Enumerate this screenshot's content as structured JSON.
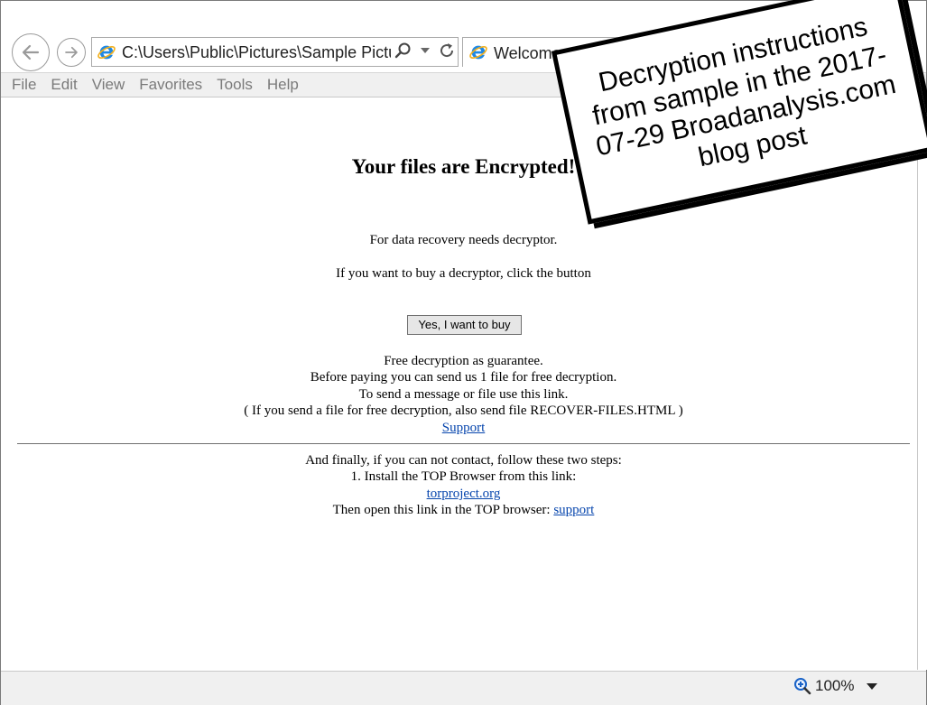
{
  "browser": {
    "address": "C:\\Users\\Public\\Pictures\\Sample Pictu",
    "tab_title": "Welcome",
    "menu": [
      "File",
      "Edit",
      "View",
      "Favorites",
      "Tools",
      "Help"
    ],
    "zoom": "100%"
  },
  "page": {
    "heading": "Your files are Encrypted!",
    "line1": "For data recovery needs decryptor.",
    "line2": "If you want to buy a decryptor, click the button",
    "button_label": "Yes, I want to buy",
    "guarantee": "Free decryption as guarantee.",
    "before_paying": "Before paying you can send us 1 file for free decryption.",
    "send_message": "To send a message or file use this link.",
    "file_note": "( If you send a file for free decryption, also send file RECOVER-FILES.HTML )",
    "support_link": "Support",
    "finally": "And finally, if you can not contact, follow these two steps:",
    "step1": "1. Install the TOP Browser from this link:",
    "tor_link": "torproject.org",
    "step2_prefix": "Then open this link in the TOP browser:",
    "step2_link": "support"
  },
  "annotation": {
    "text": "Decryption instructions from sample in the 2017-07-29 Broadanalysis.com blog post"
  },
  "colors": {
    "link": "#0645ad",
    "menu_text": "#7a7a7a",
    "chrome_bg": "#f0f0f0"
  },
  "icons": [
    "back-arrow-icon",
    "forward-arrow-icon",
    "ie-logo-icon",
    "search-icon",
    "dropdown-icon",
    "refresh-icon",
    "zoom-icon",
    "gear-icon"
  ]
}
